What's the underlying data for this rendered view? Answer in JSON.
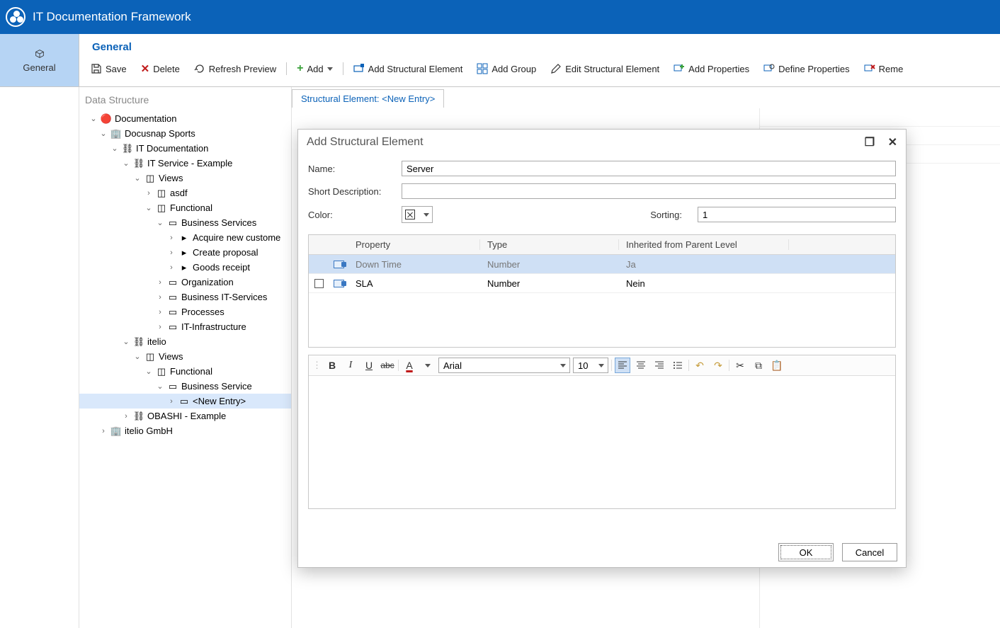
{
  "app": {
    "title": "IT Documentation Framework"
  },
  "sidetab": {
    "label": "General"
  },
  "section": {
    "title": "General"
  },
  "toolbar": {
    "save": "Save",
    "delete": "Delete",
    "refresh": "Refresh Preview",
    "add": "Add",
    "add_structural": "Add Structural Element",
    "add_group": "Add Group",
    "edit_structural": "Edit Structural Element",
    "add_properties": "Add Properties",
    "define_properties": "Define Properties",
    "remove": "Reme"
  },
  "tree": {
    "title": "Data Structure",
    "nodes": {
      "documentation": "Documentation",
      "docusnap": "Docusnap Sports",
      "itdoc": "IT Documentation",
      "itservice": "IT Service - Example",
      "views1": "Views",
      "asdf": "asdf",
      "functional1": "Functional",
      "bizsvc": "Business Services",
      "acquire": "Acquire new custome",
      "proposal": "Create proposal",
      "goods": "Goods receipt",
      "org": "Organization",
      "bizit": "Business IT-Services",
      "processes": "Processes",
      "itinfra": "IT-Infrastructure",
      "itelio": "itelio",
      "views2": "Views",
      "functional2": "Functional",
      "bizsvc2": "Business Service",
      "newentry": "<New Entry>",
      "obashi": "OBASHI - Example",
      "iteliogmbh": "itelio GmbH"
    }
  },
  "tab": {
    "prefix": "Structural Element: ",
    "value": "<New Entry>"
  },
  "dialog": {
    "title": "Add Structural Element",
    "labels": {
      "name": "Name:",
      "short_desc": "Short Description:",
      "color": "Color:",
      "sorting": "Sorting:"
    },
    "values": {
      "name": "Server",
      "short_desc": "",
      "sorting": "1"
    },
    "grid": {
      "headers": {
        "property": "Property",
        "type": "Type",
        "inherited": "Inherited from Parent Level"
      },
      "rows": [
        {
          "property": "Down Time",
          "type": "Number",
          "inherited": "Ja",
          "selected": true
        },
        {
          "property": "SLA",
          "type": "Number",
          "inherited": "Nein",
          "selected": false
        }
      ]
    },
    "rtx": {
      "font": "Arial",
      "size": "10"
    },
    "buttons": {
      "ok": "OK",
      "cancel": "Cancel"
    }
  }
}
